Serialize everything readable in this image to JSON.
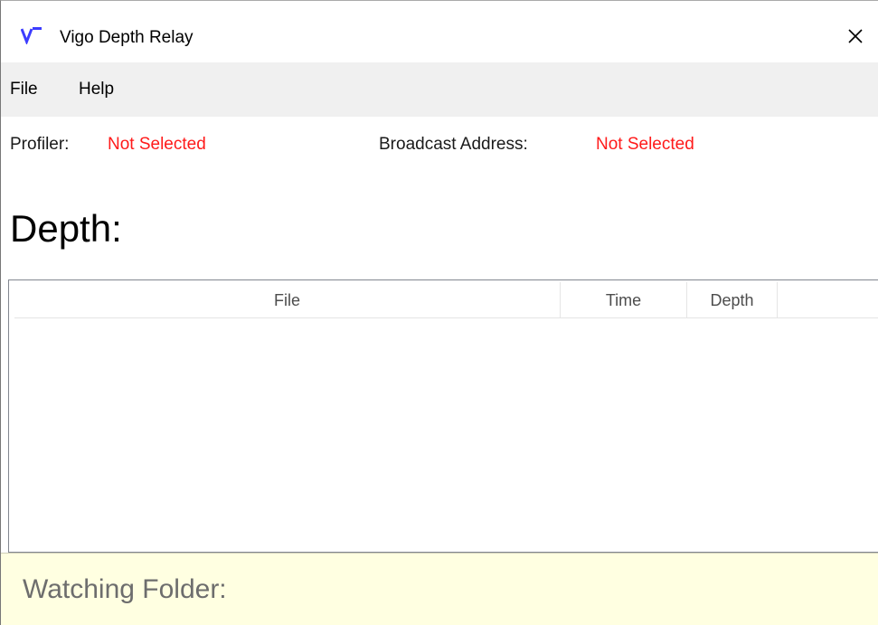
{
  "window": {
    "title": "Vigo Depth Relay",
    "icon": "vigo-logo-icon",
    "close_icon": "close-icon"
  },
  "menu": {
    "items": [
      {
        "label": "File"
      },
      {
        "label": "Help"
      }
    ]
  },
  "status": {
    "profiler_label": "Profiler:",
    "profiler_value": "Not Selected",
    "broadcast_label": "Broadcast Address:",
    "broadcast_value": "Not Selected"
  },
  "depth": {
    "label": "Depth:"
  },
  "table": {
    "columns": [
      {
        "label": "File"
      },
      {
        "label": "Time"
      },
      {
        "label": "Depth"
      }
    ],
    "rows": []
  },
  "footer": {
    "watching_label": "Watching Folder:"
  },
  "colors": {
    "accent_blue": "#3c3cff",
    "status_red": "#ff1a1a",
    "footer_bg": "#ffffe1"
  }
}
